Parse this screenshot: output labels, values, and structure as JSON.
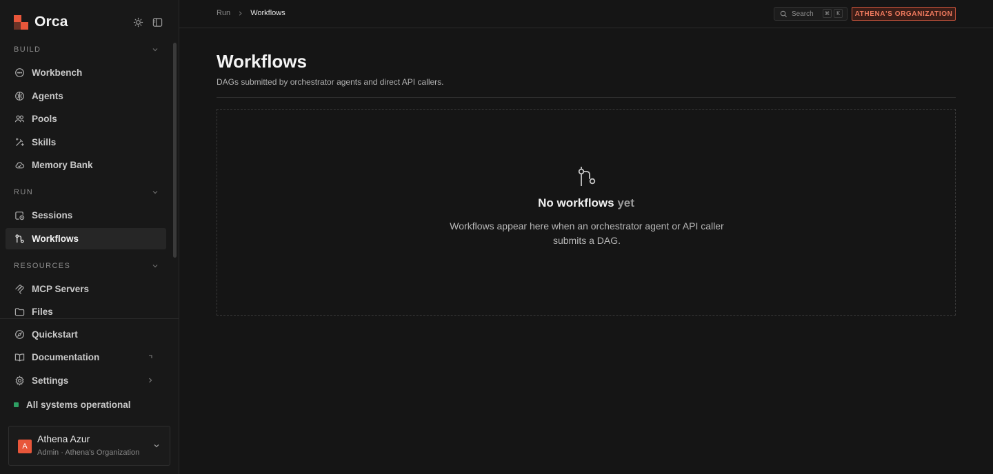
{
  "brand": {
    "name": "Orca",
    "accent": "#e8563a"
  },
  "sidebar": {
    "tools": [
      {
        "icon": "sun-icon"
      },
      {
        "icon": "sidebar-toggle-icon"
      }
    ],
    "sections": [
      {
        "label": "BUILD",
        "items": [
          {
            "label": "Workbench",
            "icon": "chat-bubble-icon"
          },
          {
            "label": "Agents",
            "icon": "brain-icon"
          },
          {
            "label": "Pools",
            "icon": "users-icon"
          },
          {
            "label": "Skills",
            "icon": "magic-wand-icon"
          },
          {
            "label": "Memory Bank",
            "icon": "cloud-icon"
          }
        ]
      },
      {
        "label": "RUN",
        "items": [
          {
            "label": "Sessions",
            "icon": "session-clock-icon"
          },
          {
            "label": "Workflows",
            "icon": "workflow-icon",
            "active": true
          }
        ]
      },
      {
        "label": "RESOURCES",
        "items": [
          {
            "label": "MCP Servers",
            "icon": "mcp-icon"
          },
          {
            "label": "Files",
            "icon": "folder-icon"
          }
        ]
      }
    ],
    "bottom_items": [
      {
        "label": "Quickstart",
        "icon": "compass-icon"
      },
      {
        "label": "Documentation",
        "icon": "book-icon",
        "trail": "external-link-icon"
      },
      {
        "label": "Settings",
        "icon": "gear-icon",
        "trail": "chevron-right-icon"
      }
    ],
    "status": {
      "label": "All systems operational",
      "color": "#2e9f63"
    },
    "user": {
      "initial": "A",
      "name": "Athena Azur",
      "role": "Admin · Athena's Organization"
    }
  },
  "topbar": {
    "breadcrumb": [
      "Run",
      "Workflows"
    ],
    "search": {
      "placeholder": "Search",
      "shortcut": [
        "⌘",
        "K"
      ]
    },
    "org_badge": "ATHENA'S ORGANIZATION"
  },
  "main": {
    "title": "Workflows",
    "subtitle": "DAGs submitted by orchestrator agents and direct API callers.",
    "empty_state": {
      "title_strong": "No workflows",
      "title_dim": " yet",
      "description": "Workflows appear here when an orchestrator agent or API caller submits a DAG."
    }
  }
}
